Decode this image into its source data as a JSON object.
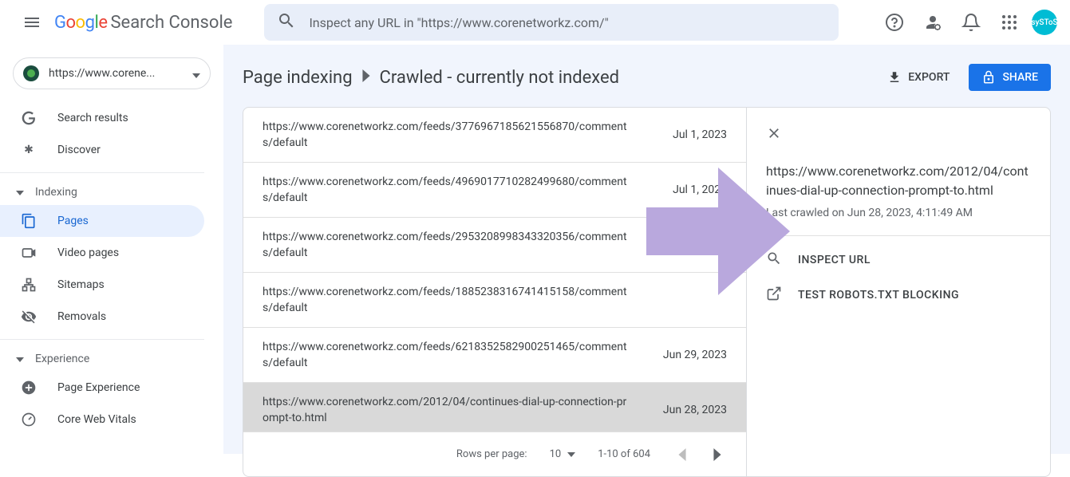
{
  "header": {
    "product_name": "Search Console",
    "search_placeholder": "Inspect any URL in \"https://www.corenetworkz.com/\"",
    "avatar_text": "sySToS"
  },
  "sidebar": {
    "property": "https://www.corene...",
    "items_top": [
      {
        "label": "Search results"
      },
      {
        "label": "Discover"
      }
    ],
    "section_indexing": "Indexing",
    "items_indexing": [
      {
        "label": "Pages"
      },
      {
        "label": "Video pages"
      },
      {
        "label": "Sitemaps"
      },
      {
        "label": "Removals"
      }
    ],
    "section_experience": "Experience",
    "items_experience": [
      {
        "label": "Page Experience"
      },
      {
        "label": "Core Web Vitals"
      }
    ]
  },
  "breadcrumb": {
    "parent": "Page indexing",
    "current": "Crawled - currently not indexed",
    "export": "EXPORT",
    "share": "SHARE"
  },
  "table": {
    "rows": [
      {
        "url": "https://www.corenetworkz.com/feeds/3776967185621556870/comments/default",
        "date": "Jul 1, 2023"
      },
      {
        "url": "https://www.corenetworkz.com/feeds/4969017710282499680/comments/default",
        "date": "Jul 1, 2023"
      },
      {
        "url": "https://www.corenetworkz.com/feeds/2953208998343320356/comments/default",
        "date": ""
      },
      {
        "url": "https://www.corenetworkz.com/feeds/1885238316741415158/comments/default",
        "date": ""
      },
      {
        "url": "https://www.corenetworkz.com/feeds/6218352582900251465/comments/default",
        "date": "Jun 29, 2023"
      },
      {
        "url": "https://www.corenetworkz.com/2012/04/continues-dial-up-connection-prompt-to.html",
        "date": "Jun 28, 2023",
        "selected": true
      }
    ],
    "pagination": {
      "rows_label": "Rows per page:",
      "rows_value": "10",
      "range": "1-10 of 604"
    }
  },
  "detail": {
    "url": "https://www.corenetworkz.com/2012/04/continues-dial-up-connection-prompt-to.html",
    "crawled": "Last crawled on Jun 28, 2023, 4:11:49 AM",
    "inspect": "INSPECT URL",
    "robots": "TEST ROBOTS.TXT BLOCKING"
  }
}
